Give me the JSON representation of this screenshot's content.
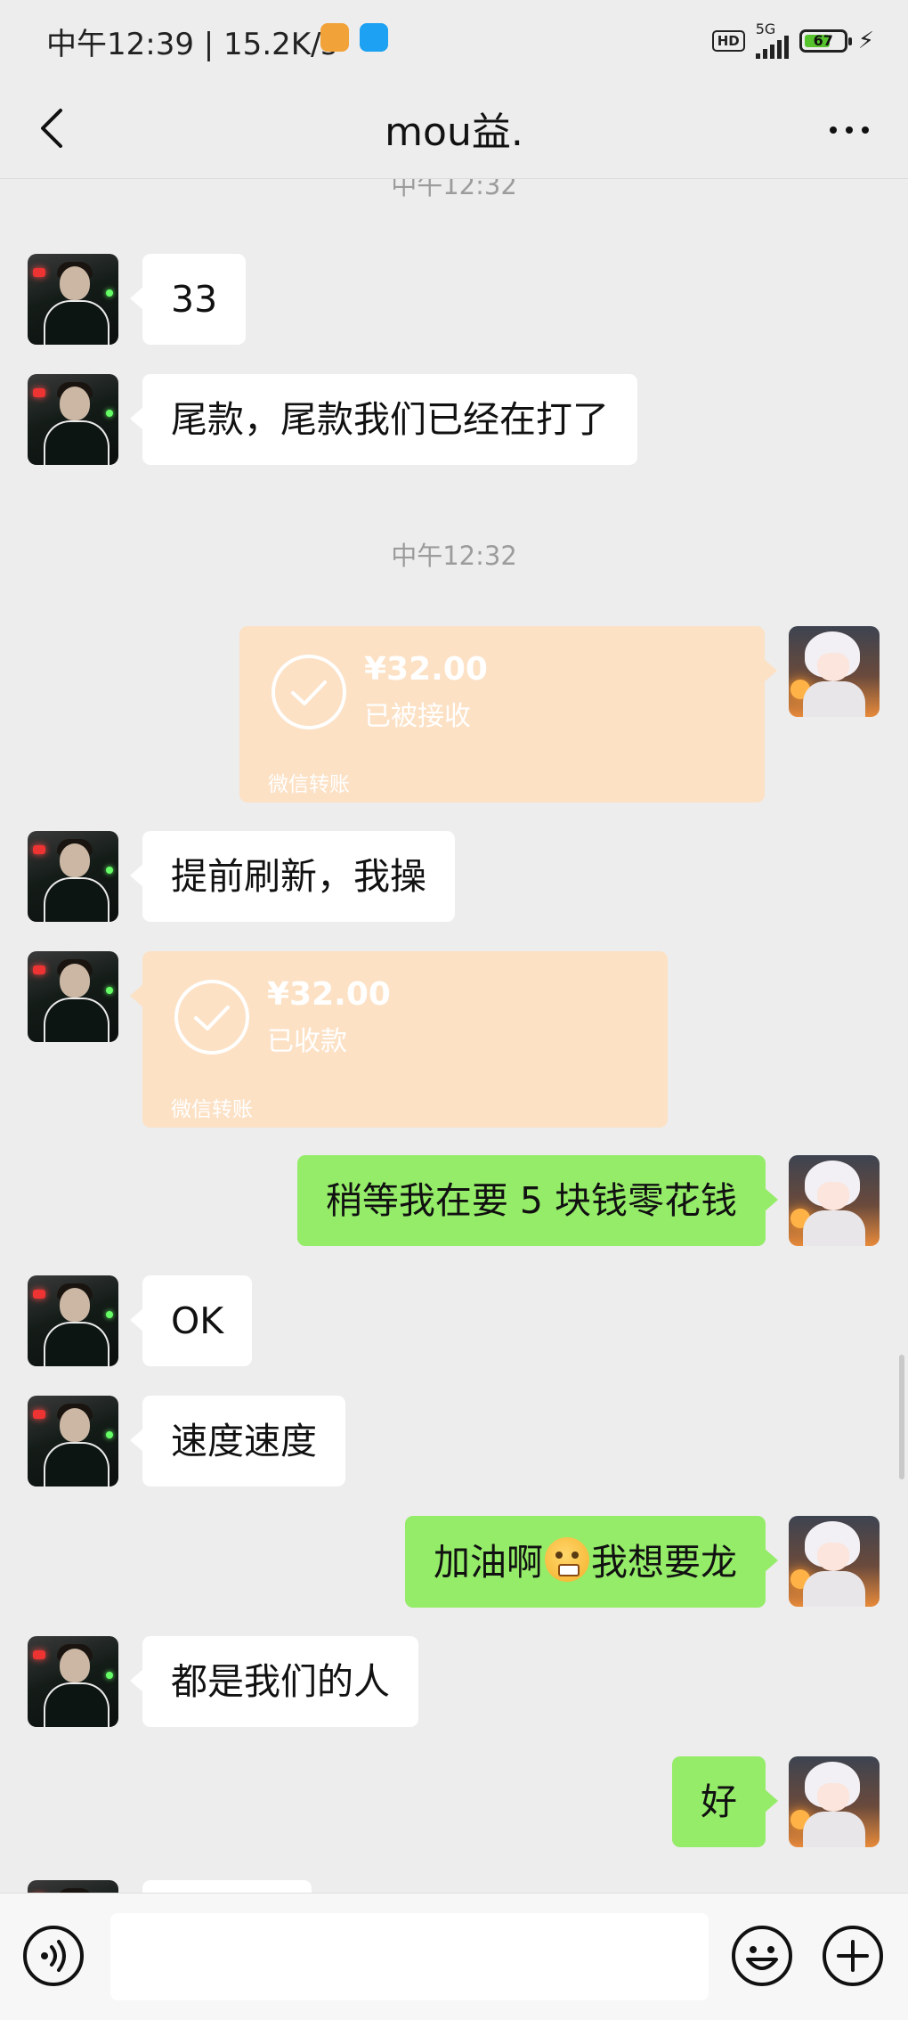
{
  "status_bar": {
    "time_and_speed": "中午12:39 | 15.2K/s",
    "hd": "HD",
    "network": "5G",
    "battery": "67"
  },
  "header": {
    "title": "mou益."
  },
  "messages": {
    "ts0": "中午12:32",
    "m1": "33",
    "m2": "尾款，尾款我们已经在打了",
    "ts1": "中午12:32",
    "t1": {
      "amount": "¥32.00",
      "status": "已被接收",
      "label": "微信转账"
    },
    "m3": "提前刷新，我操",
    "t2": {
      "amount": "¥32.00",
      "status": "已收款",
      "label": "微信转账"
    },
    "m4": "稍等我在要 5 块钱零花钱",
    "m5": "OK",
    "m6": "速度速度",
    "m7a": "加油啊",
    "m7b": "我想要龙",
    "m8": "都是我们的人",
    "m9": "好"
  },
  "input": {
    "value": ""
  },
  "colors": {
    "sent_bubble": "#95ec69",
    "received_bubble": "#ffffff",
    "transfer_bubble": "#fce1c5",
    "background": "#ededed"
  }
}
